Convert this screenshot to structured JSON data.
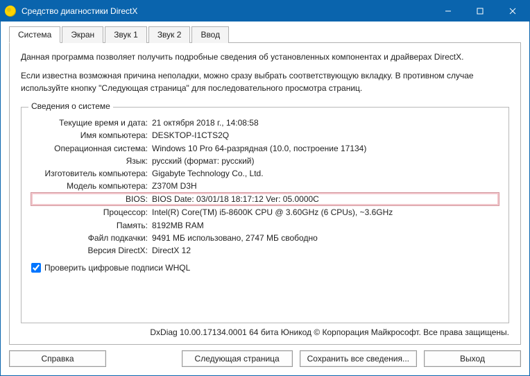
{
  "window": {
    "title": "Средство диагностики DirectX"
  },
  "tabs": [
    "Система",
    "Экран",
    "Звук 1",
    "Звук 2",
    "Ввод"
  ],
  "active_tab": 0,
  "intro": {
    "p1": "Данная программа позволяет получить подробные сведения об установленных компонентах и драйверах DirectX.",
    "p2": "Если известна возможная причина неполадки, можно сразу выбрать соответствующую вкладку. В противном случае используйте кнопку \"Следующая страница\" для последовательного просмотра страниц."
  },
  "group": {
    "legend": "Сведения о системе",
    "rows": [
      {
        "k": "Текущие время и дата:",
        "v": "21 октября 2018 г., 14:08:58"
      },
      {
        "k": "Имя компьютера:",
        "v": "DESKTOP-I1CTS2Q"
      },
      {
        "k": "Операционная система:",
        "v": "Windows 10 Pro 64-разрядная (10.0, построение 17134)"
      },
      {
        "k": "Язык:",
        "v": "русский (формат: русский)"
      },
      {
        "k": "Изготовитель компьютера:",
        "v": "Gigabyte Technology Co., Ltd."
      },
      {
        "k": "Модель компьютера:",
        "v": "Z370M D3H"
      },
      {
        "k": "BIOS:",
        "v": "BIOS Date: 03/01/18 18:17:12 Ver: 05.0000C",
        "highlight": true
      },
      {
        "k": "Процессор:",
        "v": "Intel(R) Core(TM) i5-8600K CPU @ 3.60GHz (6 CPUs), ~3.6GHz"
      },
      {
        "k": "Память:",
        "v": "8192MB RAM"
      },
      {
        "k": "Файл подкачки:",
        "v": "9491 МБ использовано, 2747 МБ свободно"
      },
      {
        "k": "Версия DirectX:",
        "v": "DirectX 12"
      }
    ]
  },
  "whql": {
    "label": "Проверить цифровые подписи WHQL",
    "checked": true
  },
  "footer": "DxDiag 10.00.17134.0001 64 бита Юникод © Корпорация Майкрософт. Все права защищены.",
  "buttons": {
    "help": "Справка",
    "next": "Следующая страница",
    "save": "Сохранить все сведения...",
    "exit": "Выход"
  }
}
